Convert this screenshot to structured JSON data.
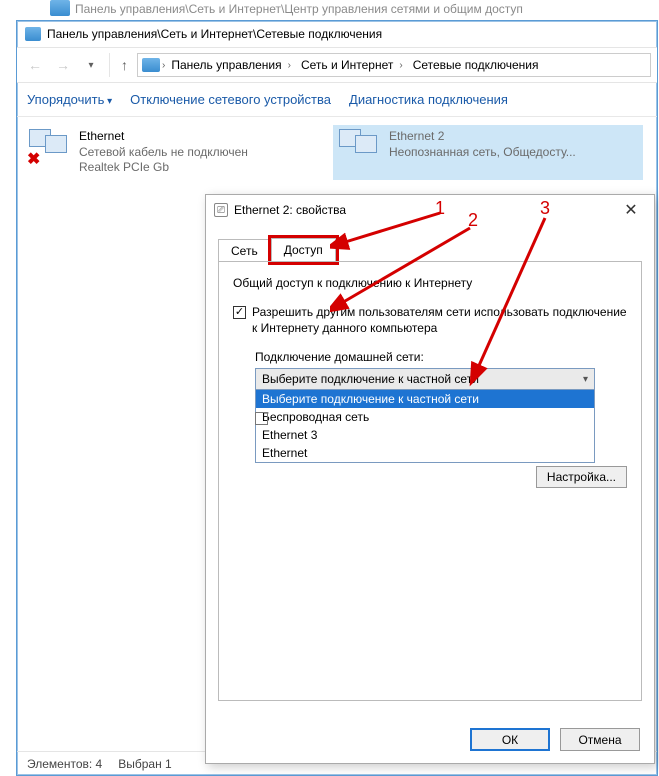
{
  "bg_window_title": "Панель управления\\Сеть и Интернет\\Центр управления сетями и общим доступ",
  "window": {
    "title": "Панель управления\\Сеть и Интернет\\Сетевые подключения",
    "breadcrumbs": [
      "Панель управления",
      "Сеть и Интернет",
      "Сетевые подключения"
    ]
  },
  "toolbar": {
    "organize": "Упорядочить",
    "disable": "Отключение сетевого устройства",
    "diagnose": "Диагностика подключения"
  },
  "connections": [
    {
      "name": "Ethernet",
      "status": "Сетевой кабель не подключен",
      "adapter": "Realtek PCIe Gb",
      "error": true
    },
    {
      "name": "Ethernet 2",
      "status": "Неопознанная сеть, Общедосту...",
      "adapter": "",
      "selected": true
    }
  ],
  "statusbar": {
    "elements": "Элементов: 4",
    "selected": "Выбран 1"
  },
  "dialog": {
    "title": "Ethernet 2: свойства",
    "tabs": [
      "Сеть",
      "Доступ"
    ],
    "active_tab": 1,
    "group_legend": "Общий доступ к подключению к Интернету",
    "checkbox_label": "Разрешить другим пользователям сети использовать подключение к Интернету данного компьютера",
    "checkbox_checked": true,
    "home_conn_label": "Подключение домашней сети:",
    "combo_selected": "Выберите подключение к частной сети",
    "combo_items": [
      "Выберите подключение к частной сети",
      "Беспроводная сеть",
      "Ethernet 3",
      "Ethernet"
    ],
    "settings_btn": "Настройка...",
    "ok": "ОК",
    "cancel": "Отмена"
  },
  "annotations": {
    "n1": "1",
    "n2": "2",
    "n3": "3"
  }
}
